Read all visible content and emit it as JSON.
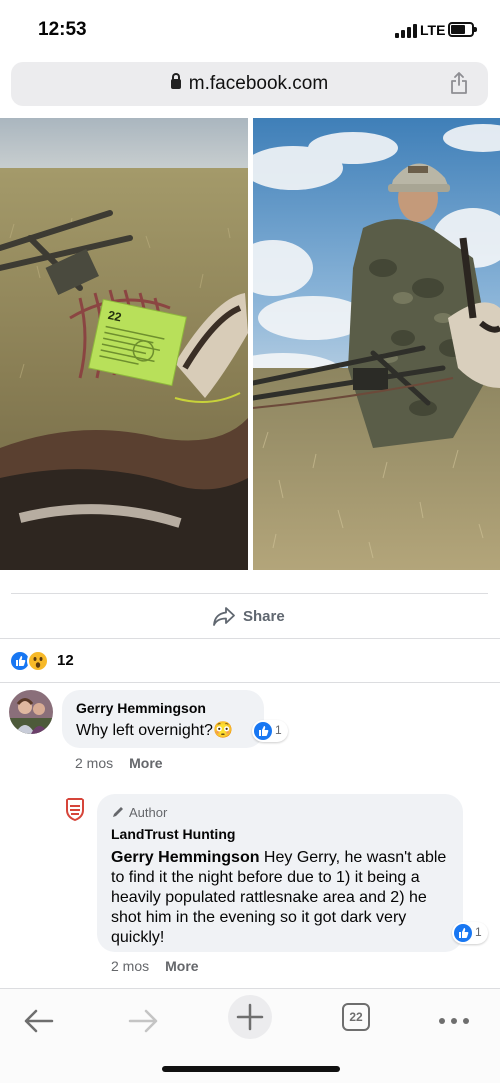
{
  "status_bar": {
    "time": "12:53",
    "network": "LTE",
    "battery_level": 0.7
  },
  "browser": {
    "url": "m.facebook.com",
    "tabs_count": "22"
  },
  "post": {
    "photos": [
      {
        "icon": "photo-pronghorn-tagged"
      },
      {
        "icon": "photo-hunter-with-bow"
      }
    ],
    "tag_text": "22",
    "share_label": "Share",
    "reaction_count": "12"
  },
  "comments": [
    {
      "author": "Gerry Hemmingson",
      "text": "Why left overnight?😳",
      "likes": "1",
      "time": "2 mos",
      "more": "More"
    }
  ],
  "reply": {
    "badge": "Author",
    "author": "LandTrust Hunting",
    "mention": "Gerry Hemmingson",
    "text": " Hey Gerry, he wasn't able to find it the night before due to 1) it being a heavily populated rattlesnake area and 2) he shot him in the evening so it got dark very quickly!",
    "likes": "1",
    "time": "2 mos",
    "more": "More"
  },
  "colors": {
    "accent": "#1877f2",
    "meta": "#65676b",
    "bubble": "#f0f2f5"
  }
}
